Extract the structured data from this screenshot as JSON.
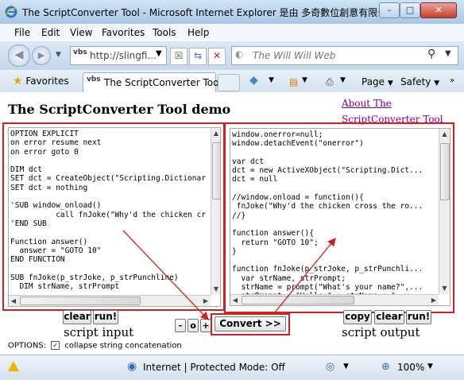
{
  "window": {
    "title": "The ScriptConverter Tool - Microsoft Internet Explorer 是由 多奇數位創意有限公...",
    "controls": {
      "minimize": "–",
      "maximize": "□",
      "close": "✕"
    }
  },
  "menu": [
    "File",
    "Edit",
    "View",
    "Favorites",
    "Tools",
    "Help"
  ],
  "address": {
    "url": "http://slingfi...",
    "site_icon": "vbs"
  },
  "search": {
    "placeholder": "The Will Will Web"
  },
  "tabs": {
    "favorites_label": "Favorites",
    "active_tab": "The ScriptConverter Tool",
    "site_icon": "vbs"
  },
  "toolbar_right": {
    "page": "Page",
    "safety": "Safety"
  },
  "page": {
    "heading": "The ScriptConverter Tool demo",
    "about_link": "About The ScriptConverter Tool",
    "input_code": "OPTION EXPLICIT\non error resume next\non error goto 0\n\nDIM dct\nSET dct = CreateObject(\"Scripting.Dictionar\nSET dct = nothing\n\n'SUB window_onload()\n          call fnJoke(\"Why'd the chicken cr\n'END SUB\n\nFunction answer()\n  answer = \"GOTO 10\"\nEND FUNCTION\n\nSUB fnJoke(p_strJoke, p_strPunchline)\n  DIM strName, strPrompt",
    "output_code": "window.onerror=null;\nwindow.detachEvent(\"onerror\")\n\nvar dct\ndct = new ActiveXObject(\"Scripting.Dict...\ndct = null\n\n//window.onload = function(){\n fnJoke(\"Why'd the chicken cross the ro...\n//}\n\nfunction answer(){\n  return \"GOTO 10\";\n}\n\nfunction fnJoke(p_strJoke, p_strPunchli...\n  var strName, strPrompt;\n  strName = prompt(\"What's your name?\",...\n  strPrompt = \"Hello \" + strName + \", w...\n  if(confirm(strPrompt)){\n    alert(p_strJoke + '\\r\\n\\r\\n' + p_st...",
    "input_buttons": {
      "clear": "clear",
      "run": "run!"
    },
    "input_caption": "script input",
    "font_buttons": {
      "smaller": "-",
      "reset": "o",
      "larger": "+"
    },
    "convert_button": "Convert >>",
    "output_buttons": {
      "copy": "copy",
      "clear": "clear",
      "run": "run!"
    },
    "output_caption": "script output",
    "options_label": "OPTIONS:",
    "options_checkbox_label": "collapse string concatenation",
    "options_checked": true
  },
  "status": {
    "zone": "Internet | Protected Mode: Off",
    "zoom": "100%"
  },
  "colors": {
    "highlight": "#d62020",
    "link": "#800080"
  }
}
